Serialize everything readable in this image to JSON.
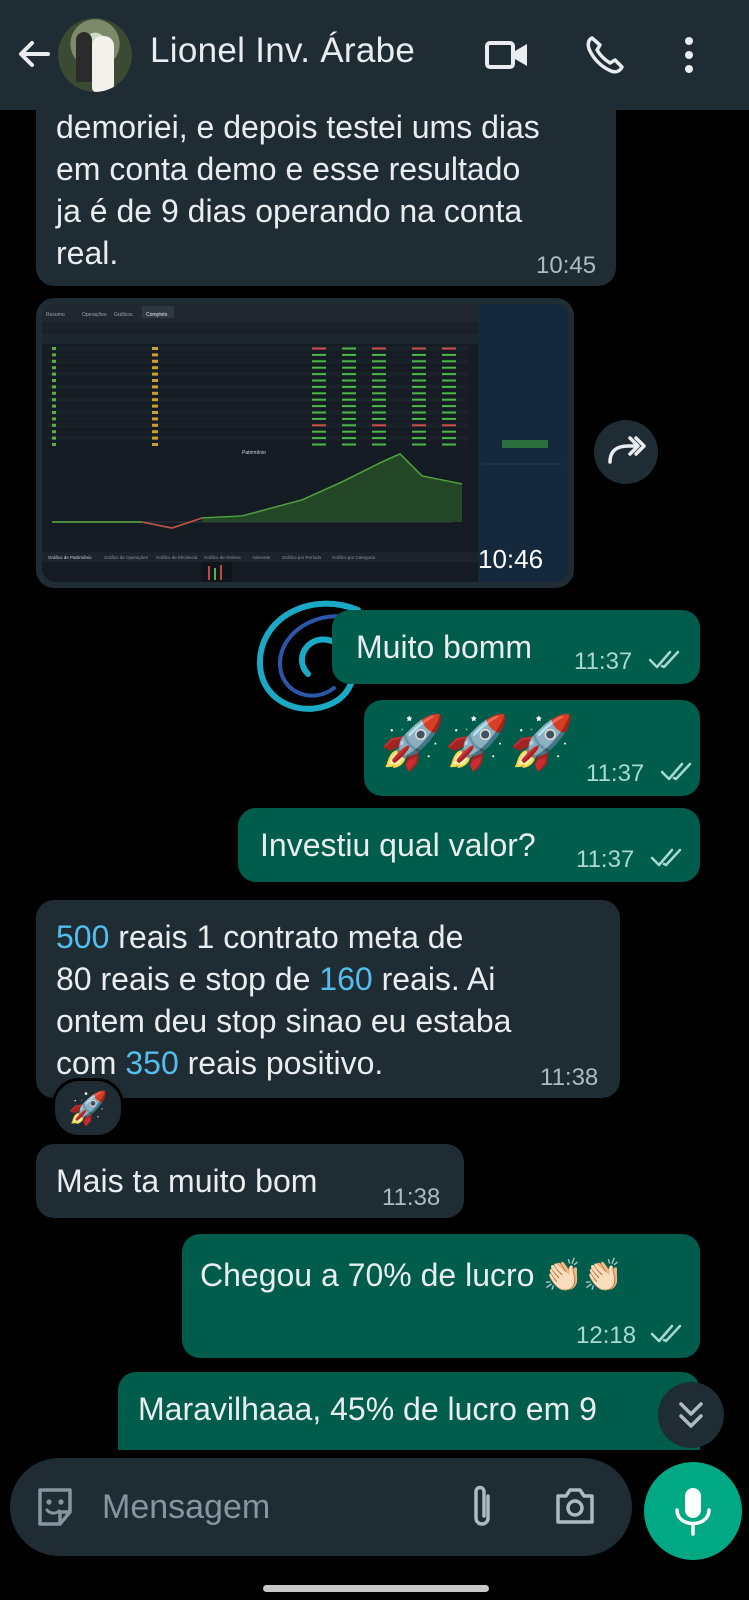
{
  "header": {
    "contact_name": "Lionel Inv. Árabe",
    "icons": [
      "back-arrow-icon",
      "video-call-icon",
      "voice-call-icon",
      "more-options-icon"
    ]
  },
  "messages": [
    {
      "direction": "incoming",
      "text_lines": [
        "demoriei, e depois testei ums dias",
        "em conta demo e esse resultado",
        "ja é de 9 dias operando na conta",
        "real."
      ],
      "time": "10:45"
    },
    {
      "direction": "incoming",
      "type": "image",
      "time": "10:46",
      "image_labels": {
        "tabs": [
          "Resumo",
          "Operações",
          "Gráficos",
          "Completo"
        ],
        "panel_title": "Patrimônio",
        "bottom_tabs": [
          "Gráfico de Patrimônio",
          "Gráfico de Operações",
          "Gráfico de Eficiência",
          "Gráfico de Ordens",
          "Aderente",
          "Gráfico por Período",
          "Gráfico por Categoria"
        ]
      }
    },
    {
      "direction": "outgoing",
      "text": "Muito bomm",
      "time": "11:37",
      "status": "read"
    },
    {
      "direction": "outgoing",
      "text": "🚀🚀🚀",
      "time": "11:37",
      "status": "read"
    },
    {
      "direction": "outgoing",
      "text": "Investiu qual valor?",
      "time": "11:37",
      "status": "read"
    },
    {
      "direction": "incoming",
      "line1_num": "500",
      "line1_rest": " reais 1 contrato meta de",
      "line2_a": "80 reais e stop de ",
      "line2_num": "160",
      "line2_b": " reais. Ai",
      "line3": "ontem deu stop sinao eu estaba",
      "line4_a": "com ",
      "line4_num": "350",
      "line4_b": " reais positivo.",
      "time": "11:38",
      "reaction": "🚀"
    },
    {
      "direction": "incoming",
      "text": "Mais ta muito bom",
      "time": "11:38"
    },
    {
      "direction": "outgoing",
      "text": "Chegou a 70% de lucro 👏🏻👏🏻",
      "time": "12:18",
      "status": "read"
    },
    {
      "direction": "outgoing",
      "text": "Maravilhaaa, 45% de lucro em 9",
      "partial": true
    }
  ],
  "composer": {
    "placeholder": "Mensagem",
    "icons": [
      "sticker-icon",
      "attach-icon",
      "camera-icon",
      "microphone-icon"
    ]
  },
  "colors": {
    "header_bg": "#1f2c34",
    "incoming_bubble": "#202c33",
    "outgoing_bubble": "#005c4b",
    "accent_green": "#00a884",
    "link_number": "#53bdeb",
    "read_tick": "#a7d9cf"
  }
}
